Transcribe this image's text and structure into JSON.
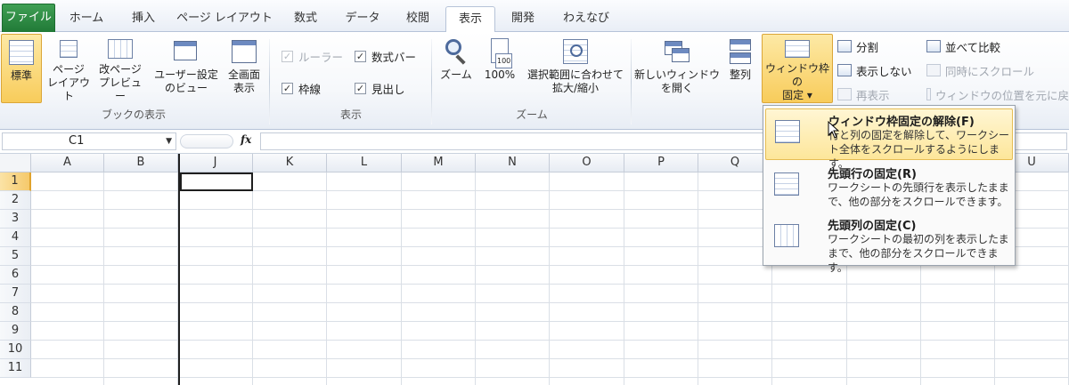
{
  "tabs": [
    "ファイル",
    "ホーム",
    "挿入",
    "ページ レイアウト",
    "数式",
    "データ",
    "校閲",
    "表示",
    "開発",
    "わえなび"
  ],
  "active_tab": "表示",
  "ribbon": {
    "workbook_views": {
      "group_label": "ブックの表示",
      "normal": "標準",
      "page_layout": [
        "ページ",
        "レイアウト"
      ],
      "page_break": [
        "改ページ",
        "プレビュー"
      ],
      "custom_views": [
        "ユーザー設定",
        "のビュー"
      ],
      "full_screen": [
        "全画面",
        "表示"
      ]
    },
    "show": {
      "group_label": "表示",
      "ruler": "ルーラー",
      "formula_bar": "数式バー",
      "gridlines": "枠線",
      "headings": "見出し",
      "check": "✓"
    },
    "zoom": {
      "group_label": "ズーム",
      "zoom": "ズーム",
      "hundred": "100%",
      "hundred_icon_text": "100",
      "zoom_selection": [
        "選択範囲に合わせて",
        "拡大/縮小"
      ]
    },
    "window": {
      "new_window": [
        "新しいウィンドウ",
        "を開く"
      ],
      "arrange": "整列",
      "freeze": [
        "ウィンドウ枠の",
        "固定 ▾"
      ],
      "split": "分割",
      "hide": "表示しない",
      "unhide": "再表示",
      "side_by_side": "並べて比較",
      "sync_scroll": "同時にスクロール",
      "reset_position": "ウィンドウの位置を元に戻"
    }
  },
  "formula_bar": {
    "name_box": "C1",
    "fx": "fx"
  },
  "grid": {
    "columns": [
      "A",
      "B",
      "J",
      "K",
      "L",
      "M",
      "N",
      "O",
      "P",
      "Q",
      "R",
      "S",
      "T",
      "U"
    ],
    "rows": [
      "1",
      "2",
      "3",
      "4",
      "5",
      "6",
      "7",
      "8",
      "9",
      "10",
      "11"
    ],
    "selected_cell": "C1"
  },
  "freeze_menu": [
    {
      "title": "ウィンドウ枠固定の解除(F)",
      "desc": [
        "行と列の固定を解除して、ワークシー",
        "ト全体をスクロールするようにします。"
      ]
    },
    {
      "title": "先頭行の固定(R)",
      "desc": [
        "ワークシートの先頭行を表示したまま",
        "で、他の部分をスクロールできます。"
      ]
    },
    {
      "title": "先頭列の固定(C)",
      "desc": [
        "ワークシートの最初の列を表示したま",
        "まで、他の部分をスクロールできます。"
      ]
    }
  ],
  "colors": {
    "file_tab": "#217a37",
    "highlight": "#f8cc5b",
    "menu_highlight": "#fde69a"
  }
}
